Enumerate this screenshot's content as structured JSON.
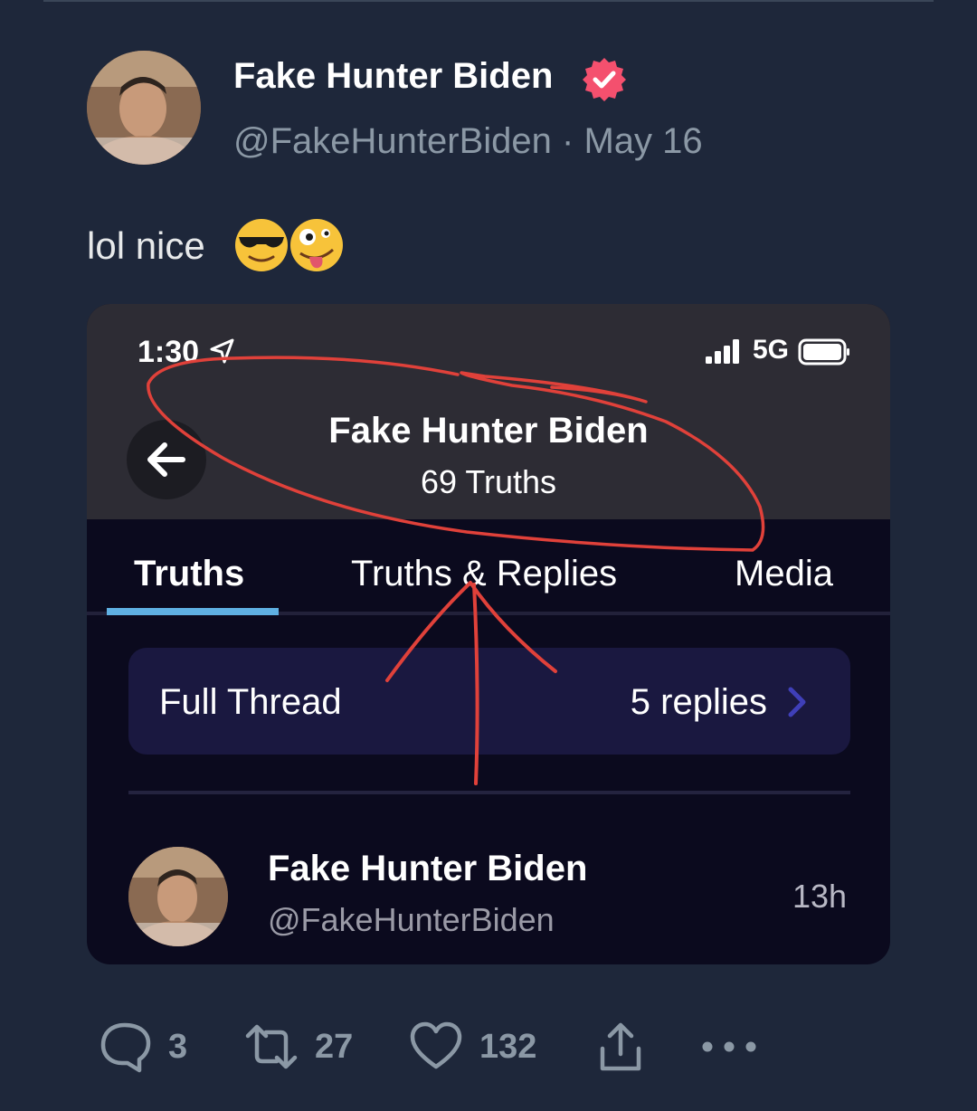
{
  "tweet": {
    "author_name": "Fake Hunter Biden",
    "handle": "@FakeHunterBiden",
    "separator": "·",
    "date": "May 16",
    "text": "lol nice",
    "emoji_names": [
      "sunglasses-face-emoji",
      "zany-face-emoji"
    ]
  },
  "embedded_screenshot": {
    "status_bar": {
      "time": "1:30",
      "network": "5G"
    },
    "profile": {
      "name": "Fake Hunter Biden",
      "truth_count": "69 Truths"
    },
    "tabs": [
      {
        "label": "Truths",
        "active": true
      },
      {
        "label": "Truths & Replies",
        "active": false
      },
      {
        "label": "Media",
        "active": false
      }
    ],
    "thread": {
      "label": "Full Thread",
      "replies": "5 replies"
    },
    "post": {
      "name": "Fake Hunter Biden",
      "handle": "@FakeHunterBiden",
      "time": "13h"
    }
  },
  "actions": {
    "replies": "3",
    "retweets": "27",
    "likes": "132"
  },
  "colors": {
    "background": "#1e273a",
    "verified_badge": "#f4506e",
    "muted_text": "#8b98a5",
    "card_background": "#0b0a1e",
    "tab_underline": "#5fb0e3",
    "annotation_red": "#e0413a"
  },
  "icons": [
    "verified-badge-icon",
    "back-arrow-icon",
    "location-arrow-icon",
    "signal-bars-icon",
    "battery-icon",
    "chevron-right-icon",
    "reply-icon",
    "retweet-icon",
    "like-icon",
    "share-icon",
    "more-icon"
  ]
}
